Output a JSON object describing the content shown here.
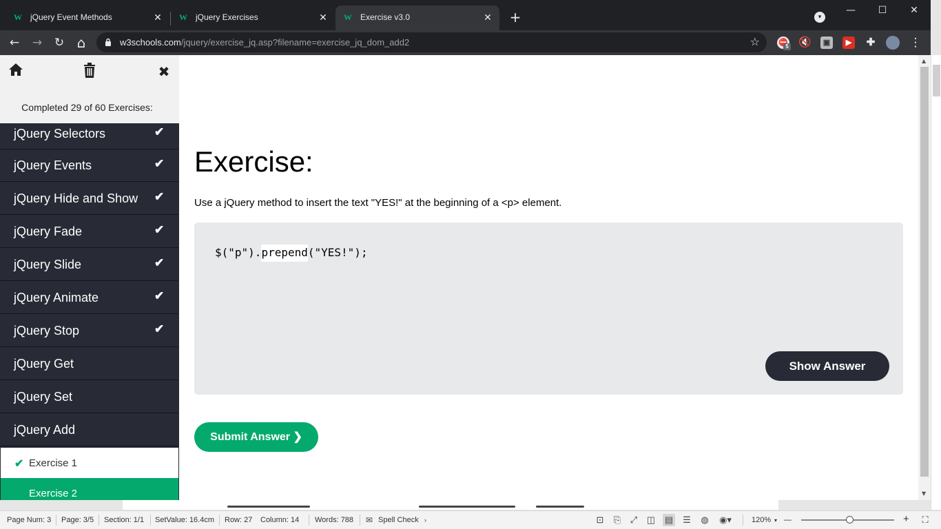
{
  "browser": {
    "tabs": [
      {
        "label": "jQuery Event Methods",
        "favicon": "W",
        "active": false
      },
      {
        "label": "jQuery Exercises",
        "favicon": "W",
        "active": false
      },
      {
        "label": "Exercise v3.0",
        "favicon": "W",
        "active": true
      }
    ],
    "close_glyph": "✕",
    "new_tab_glyph": "+",
    "tab_search_glyph": "▾",
    "window": {
      "minimize": "—",
      "maximize": "☐",
      "close": "✕"
    },
    "nav": {
      "back": "←",
      "forward": "→",
      "reload": "↻",
      "home": "⌂"
    },
    "address": {
      "host": "w3schools.com",
      "path": "/jquery/exercise_jq.asp?filename=exercise_jq_dom_add2"
    },
    "star_glyph": "☆",
    "extensions": [
      {
        "name": "adblock-extension-icon",
        "badge": "5",
        "color": "#e0e0e0"
      },
      {
        "name": "mute-tab-extension-icon",
        "color": "#35363a"
      },
      {
        "name": "clip-extension-icon",
        "color": "#bbbbbb"
      },
      {
        "name": "video-extension-icon",
        "color": "#d93025"
      },
      {
        "name": "puzzle-extensions-icon",
        "color": "#35363a"
      }
    ],
    "menu_glyph": "⋮"
  },
  "sidebar": {
    "tools": {
      "home": "⌂",
      "trash": "🗑",
      "close": "✖"
    },
    "completed_label": "Completed 29 of 60 Exercises:",
    "categories": [
      {
        "label": "jQuery Selectors",
        "done": true
      },
      {
        "label": "jQuery Events",
        "done": true
      },
      {
        "label": "jQuery Hide and Show",
        "done": true
      },
      {
        "label": "jQuery Fade",
        "done": true
      },
      {
        "label": "jQuery Slide",
        "done": true
      },
      {
        "label": "jQuery Animate",
        "done": true
      },
      {
        "label": "jQuery Stop",
        "done": true
      },
      {
        "label": "jQuery Get",
        "done": false
      },
      {
        "label": "jQuery Set",
        "done": false
      },
      {
        "label": "jQuery Add",
        "done": false
      }
    ],
    "check_glyph": "✔",
    "exercises": [
      {
        "label": "Exercise 1",
        "done": true,
        "current": false
      },
      {
        "label": "Exercise 2",
        "done": false,
        "current": true
      }
    ]
  },
  "exercise": {
    "heading": "Exercise:",
    "instruction": "Use a jQuery method to insert the text \"YES!\" at the beginning of a <p> element.",
    "code_prefix": "$(\"p\").",
    "code_answer": "prepend",
    "code_suffix": "(\"YES!\");",
    "show_answer_label": "Show Answer",
    "submit_label": "Submit Answer ❯"
  },
  "statusbar": {
    "page_num": "Page Num: 3",
    "page": "Page: 3/5",
    "section": "Section: 1/1",
    "setvalue": "SetValue: 16.4cm",
    "row": "Row: 27",
    "column": "Column: 14",
    "words": "Words: 788",
    "spell_check": "Spell Check",
    "zoom": "120%",
    "zoom_out": "—",
    "zoom_in": "+"
  },
  "colors": {
    "w3_green": "#04aa6d",
    "sidebar_dark": "#282a35",
    "code_bg": "#e7e9eb"
  }
}
